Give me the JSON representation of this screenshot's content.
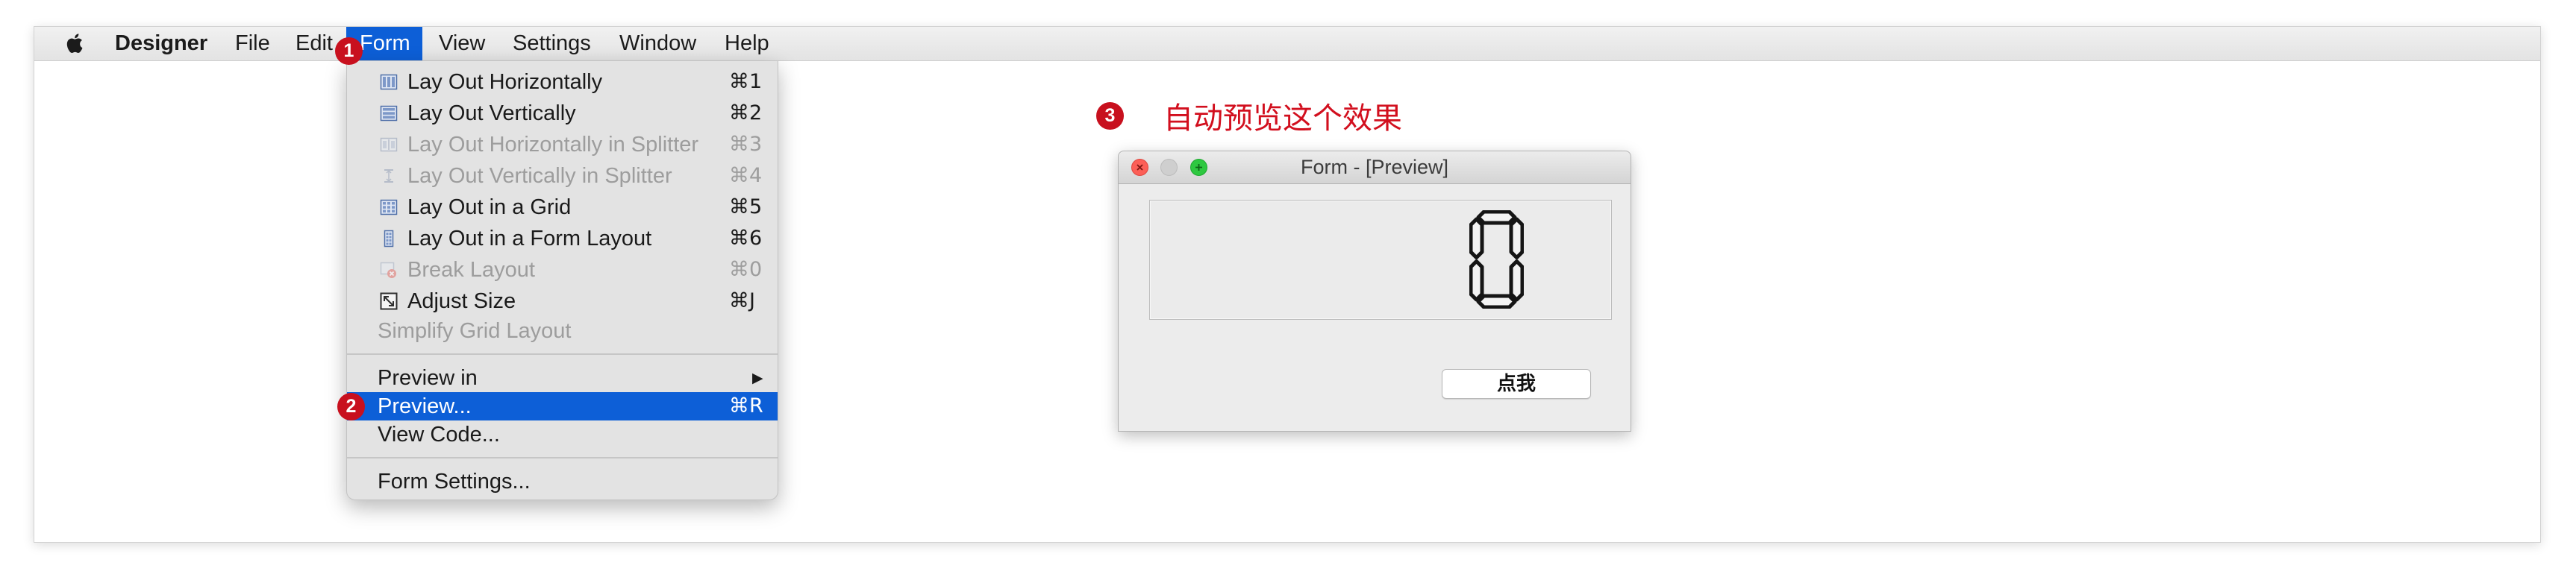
{
  "colors": {
    "menu_highlight": "#0d5fd7",
    "badge_red": "#c8101e",
    "annotation_red": "#d20f1e",
    "disabled_text": "#9d9d9d"
  },
  "menubar": {
    "apple_icon": "apple-logo-icon",
    "app_name": "Designer",
    "items": [
      {
        "label": "File"
      },
      {
        "label": "Edit"
      },
      {
        "label": "Form",
        "active": true
      },
      {
        "label": "View"
      },
      {
        "label": "Settings"
      },
      {
        "label": "Window"
      },
      {
        "label": "Help"
      }
    ]
  },
  "form_menu": {
    "items": [
      {
        "label": "Lay Out Horizontally",
        "shortcut": "⌘1",
        "icon": "layout-horizontal-icon",
        "enabled": true
      },
      {
        "label": "Lay Out Vertically",
        "shortcut": "⌘2",
        "icon": "layout-vertical-icon",
        "enabled": true
      },
      {
        "label": "Lay Out Horizontally in Splitter",
        "shortcut": "⌘3",
        "icon": "splitter-horizontal-icon",
        "enabled": false
      },
      {
        "label": "Lay Out Vertically in Splitter",
        "shortcut": "⌘4",
        "icon": "splitter-vertical-icon",
        "enabled": false
      },
      {
        "label": "Lay Out in a Grid",
        "shortcut": "⌘5",
        "icon": "layout-grid-icon",
        "enabled": true
      },
      {
        "label": "Lay Out in a Form Layout",
        "shortcut": "⌘6",
        "icon": "layout-form-icon",
        "enabled": true
      },
      {
        "label": "Break Layout",
        "shortcut": "⌘0",
        "icon": "break-layout-icon",
        "enabled": false
      },
      {
        "label": "Adjust Size",
        "shortcut": "⌘J",
        "icon": "adjust-size-icon",
        "enabled": true
      },
      {
        "label": "Simplify Grid Layout",
        "enabled": false
      }
    ],
    "preview_in": {
      "label": "Preview in",
      "submenu_arrow": "▶"
    },
    "preview": {
      "label": "Preview...",
      "shortcut": "⌘R",
      "highlighted": true
    },
    "view_code": {
      "label": "View Code..."
    },
    "form_settings": {
      "label": "Form Settings..."
    }
  },
  "badges": {
    "step1": "1",
    "step2": "2",
    "step3": "3"
  },
  "annotation": {
    "text": "自动预览这个效果"
  },
  "preview_window": {
    "title": "Form - [Preview]",
    "lcd_value": "0",
    "button_label": "点我"
  }
}
